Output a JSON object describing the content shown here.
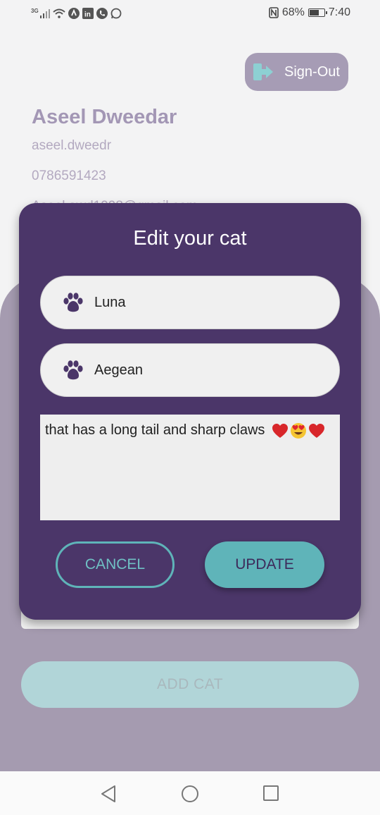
{
  "status_bar": {
    "network": "3G",
    "battery_percent": "68%",
    "battery_level": 0.68,
    "time": "7:40",
    "icons": [
      "signal-icon",
      "wifi-icon",
      "vpn-icon",
      "linkedin-icon",
      "phone-icon",
      "whatsapp-icon",
      "nfc-icon",
      "battery-icon"
    ]
  },
  "header": {
    "signout_label": "Sign-Out",
    "signout_icon": "logout-icon"
  },
  "profile": {
    "name": "Aseel Dweedar",
    "username": "aseel.dweedr",
    "phone": "0786591423",
    "email_partial": "Aseel.awd1998@gmail.com"
  },
  "dialog": {
    "title": "Edit your cat",
    "name_value": "Luna",
    "breed_value": "Aegean",
    "description_value": "that has a long tail and sharp claws",
    "description_emojis": [
      "heart-icon",
      "heart-eyes-icon",
      "heart-icon"
    ],
    "cancel_label": "CANCEL",
    "update_label": "UPDATE"
  },
  "main": {
    "add_cat_label": "ADD CAT"
  },
  "colors": {
    "dialog_bg": "#4b3669",
    "accent": "#5fb4b9",
    "panel_bg": "#a59bb0",
    "profile_text": "#a397b5"
  }
}
